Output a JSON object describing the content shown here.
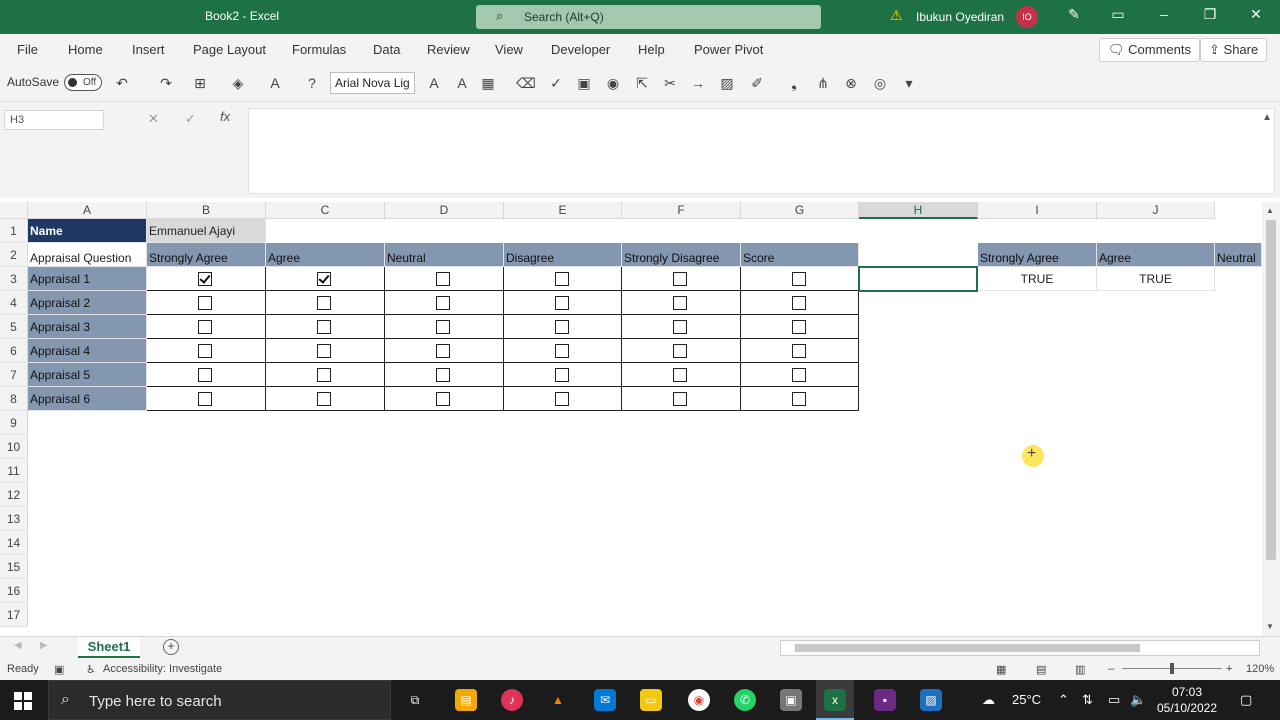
{
  "window": {
    "title": "Book2 - Excel",
    "search_placeholder": "Search (Alt+Q)",
    "user_name": "Ibukun Oyediran",
    "user_initials": "IO"
  },
  "ribbon": {
    "tabs": [
      "File",
      "Home",
      "Insert",
      "Page Layout",
      "Formulas",
      "Data",
      "Review",
      "View",
      "Developer",
      "Help",
      "Power Pivot"
    ],
    "comments_label": "Comments",
    "share_label": "Share"
  },
  "toolbar": {
    "autosave_label": "AutoSave",
    "autosave_state": "Off",
    "font_name": "Arial Nova Lig"
  },
  "formula_bar": {
    "name_box": "H3",
    "fx_label": "fx",
    "content": ""
  },
  "grid": {
    "columns": [
      "A",
      "B",
      "C",
      "D",
      "E",
      "F",
      "G",
      "H",
      "I",
      "J"
    ],
    "selected_column": "H",
    "rows": [
      "1",
      "2",
      "3",
      "4",
      "5",
      "6",
      "7",
      "8",
      "9",
      "10",
      "11",
      "12",
      "13",
      "14",
      "15",
      "16",
      "17"
    ],
    "a1": "Name",
    "b1": "Emmanuel Ajayi",
    "header_row": [
      "Appraisal Question",
      "Strongly Agree",
      "Agree",
      "Neutral",
      "Disagree",
      "Strongly Disagree",
      "Score"
    ],
    "questions": [
      "Appraisal 1",
      "Appraisal 2",
      "Appraisal 3",
      "Appraisal 4",
      "Appraisal 5",
      "Appraisal 6"
    ],
    "checkboxes": [
      [
        true,
        true,
        false,
        false,
        false,
        false
      ],
      [
        false,
        false,
        false,
        false,
        false,
        false
      ],
      [
        false,
        false,
        false,
        false,
        false,
        false
      ],
      [
        false,
        false,
        false,
        false,
        false,
        false
      ],
      [
        false,
        false,
        false,
        false,
        false,
        false
      ],
      [
        false,
        false,
        false,
        false,
        false,
        false
      ]
    ],
    "side_headers": [
      "Strongly Agree",
      "Agree",
      "Neutral"
    ],
    "i3": "TRUE",
    "j3": "TRUE"
  },
  "sheets": {
    "active": "Sheet1"
  },
  "status": {
    "ready": "Ready",
    "accessibility": "Accessibility: Investigate",
    "zoom": "120%"
  },
  "taskbar": {
    "search_placeholder": "Type here to search",
    "weather": "25°C",
    "time": "07:03",
    "date": "05/10/2022"
  },
  "colors": {
    "excel_green": "#1e7145",
    "navy_header": "#1f3864",
    "blue_header": "#8497b0"
  }
}
